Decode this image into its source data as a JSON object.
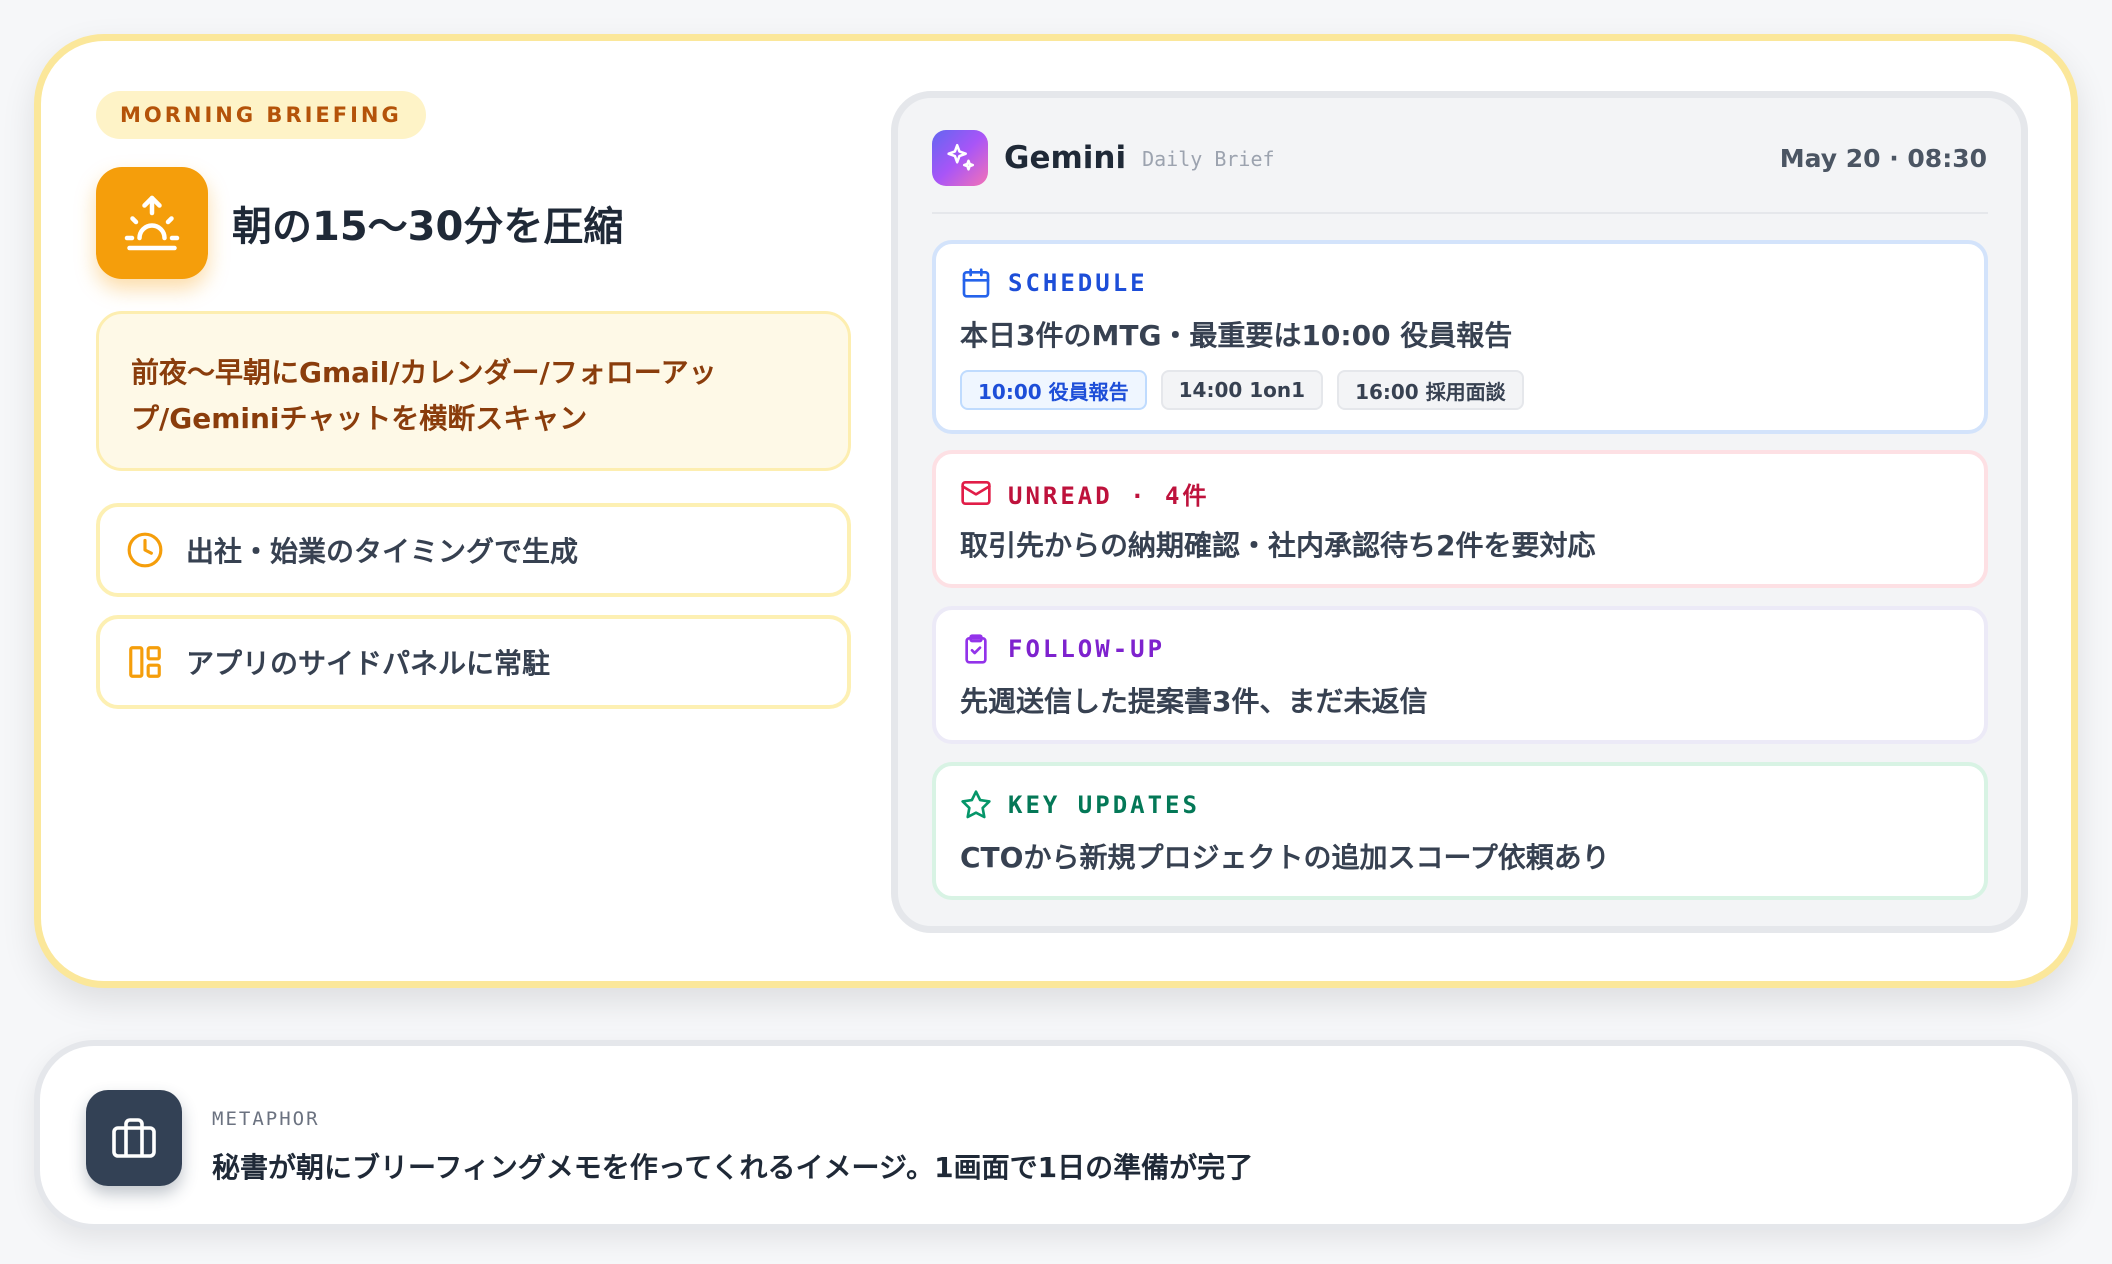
{
  "briefing": {
    "badge": "MORNING BRIEFING",
    "hero_title": "朝の15〜30分を圧縮",
    "description_line1": "前夜〜早朝にGmail/カレンダー/フォローアッ",
    "description_line2": "プ/Geminiチャットを横断スキャン",
    "features": [
      {
        "label": "出社・始業のタイミングで生成",
        "icon": "clock-icon"
      },
      {
        "label": "アプリのサイドパネルに常駐",
        "icon": "panel-layout-icon"
      }
    ]
  },
  "gemini": {
    "name": "Gemini",
    "subtitle": "Daily Brief",
    "datetime": "May 20 · 08:30",
    "schedule": {
      "label": "SCHEDULE",
      "text": "本日3件のMTG・最重要は10:00 役員報告",
      "chips": [
        "10:00 役員報告",
        "14:00 1on1",
        "16:00 採用面談"
      ]
    },
    "unread": {
      "label": "UNREAD · 4件",
      "text": "取引先からの納期確認・社内承認待ち2件を要対応"
    },
    "followup": {
      "label": "FOLLOW-UP",
      "text": "先週送信した提案書3件、まだ未返信"
    },
    "updates": {
      "label": "KEY UPDATES",
      "text": "CTOから新規プロジェクトの追加スコープ依頼あり"
    }
  },
  "metaphor": {
    "label": "METAPHOR",
    "text": "秘書が朝にブリーフィングメモを作ってくれるイメージ。1画面で1日の準備が完了"
  },
  "colors": {
    "accent": "#f59e0b",
    "schedule": "#1d4ed8",
    "unread": "#be123c",
    "followup": "#7e22ce",
    "updates": "#047857"
  }
}
